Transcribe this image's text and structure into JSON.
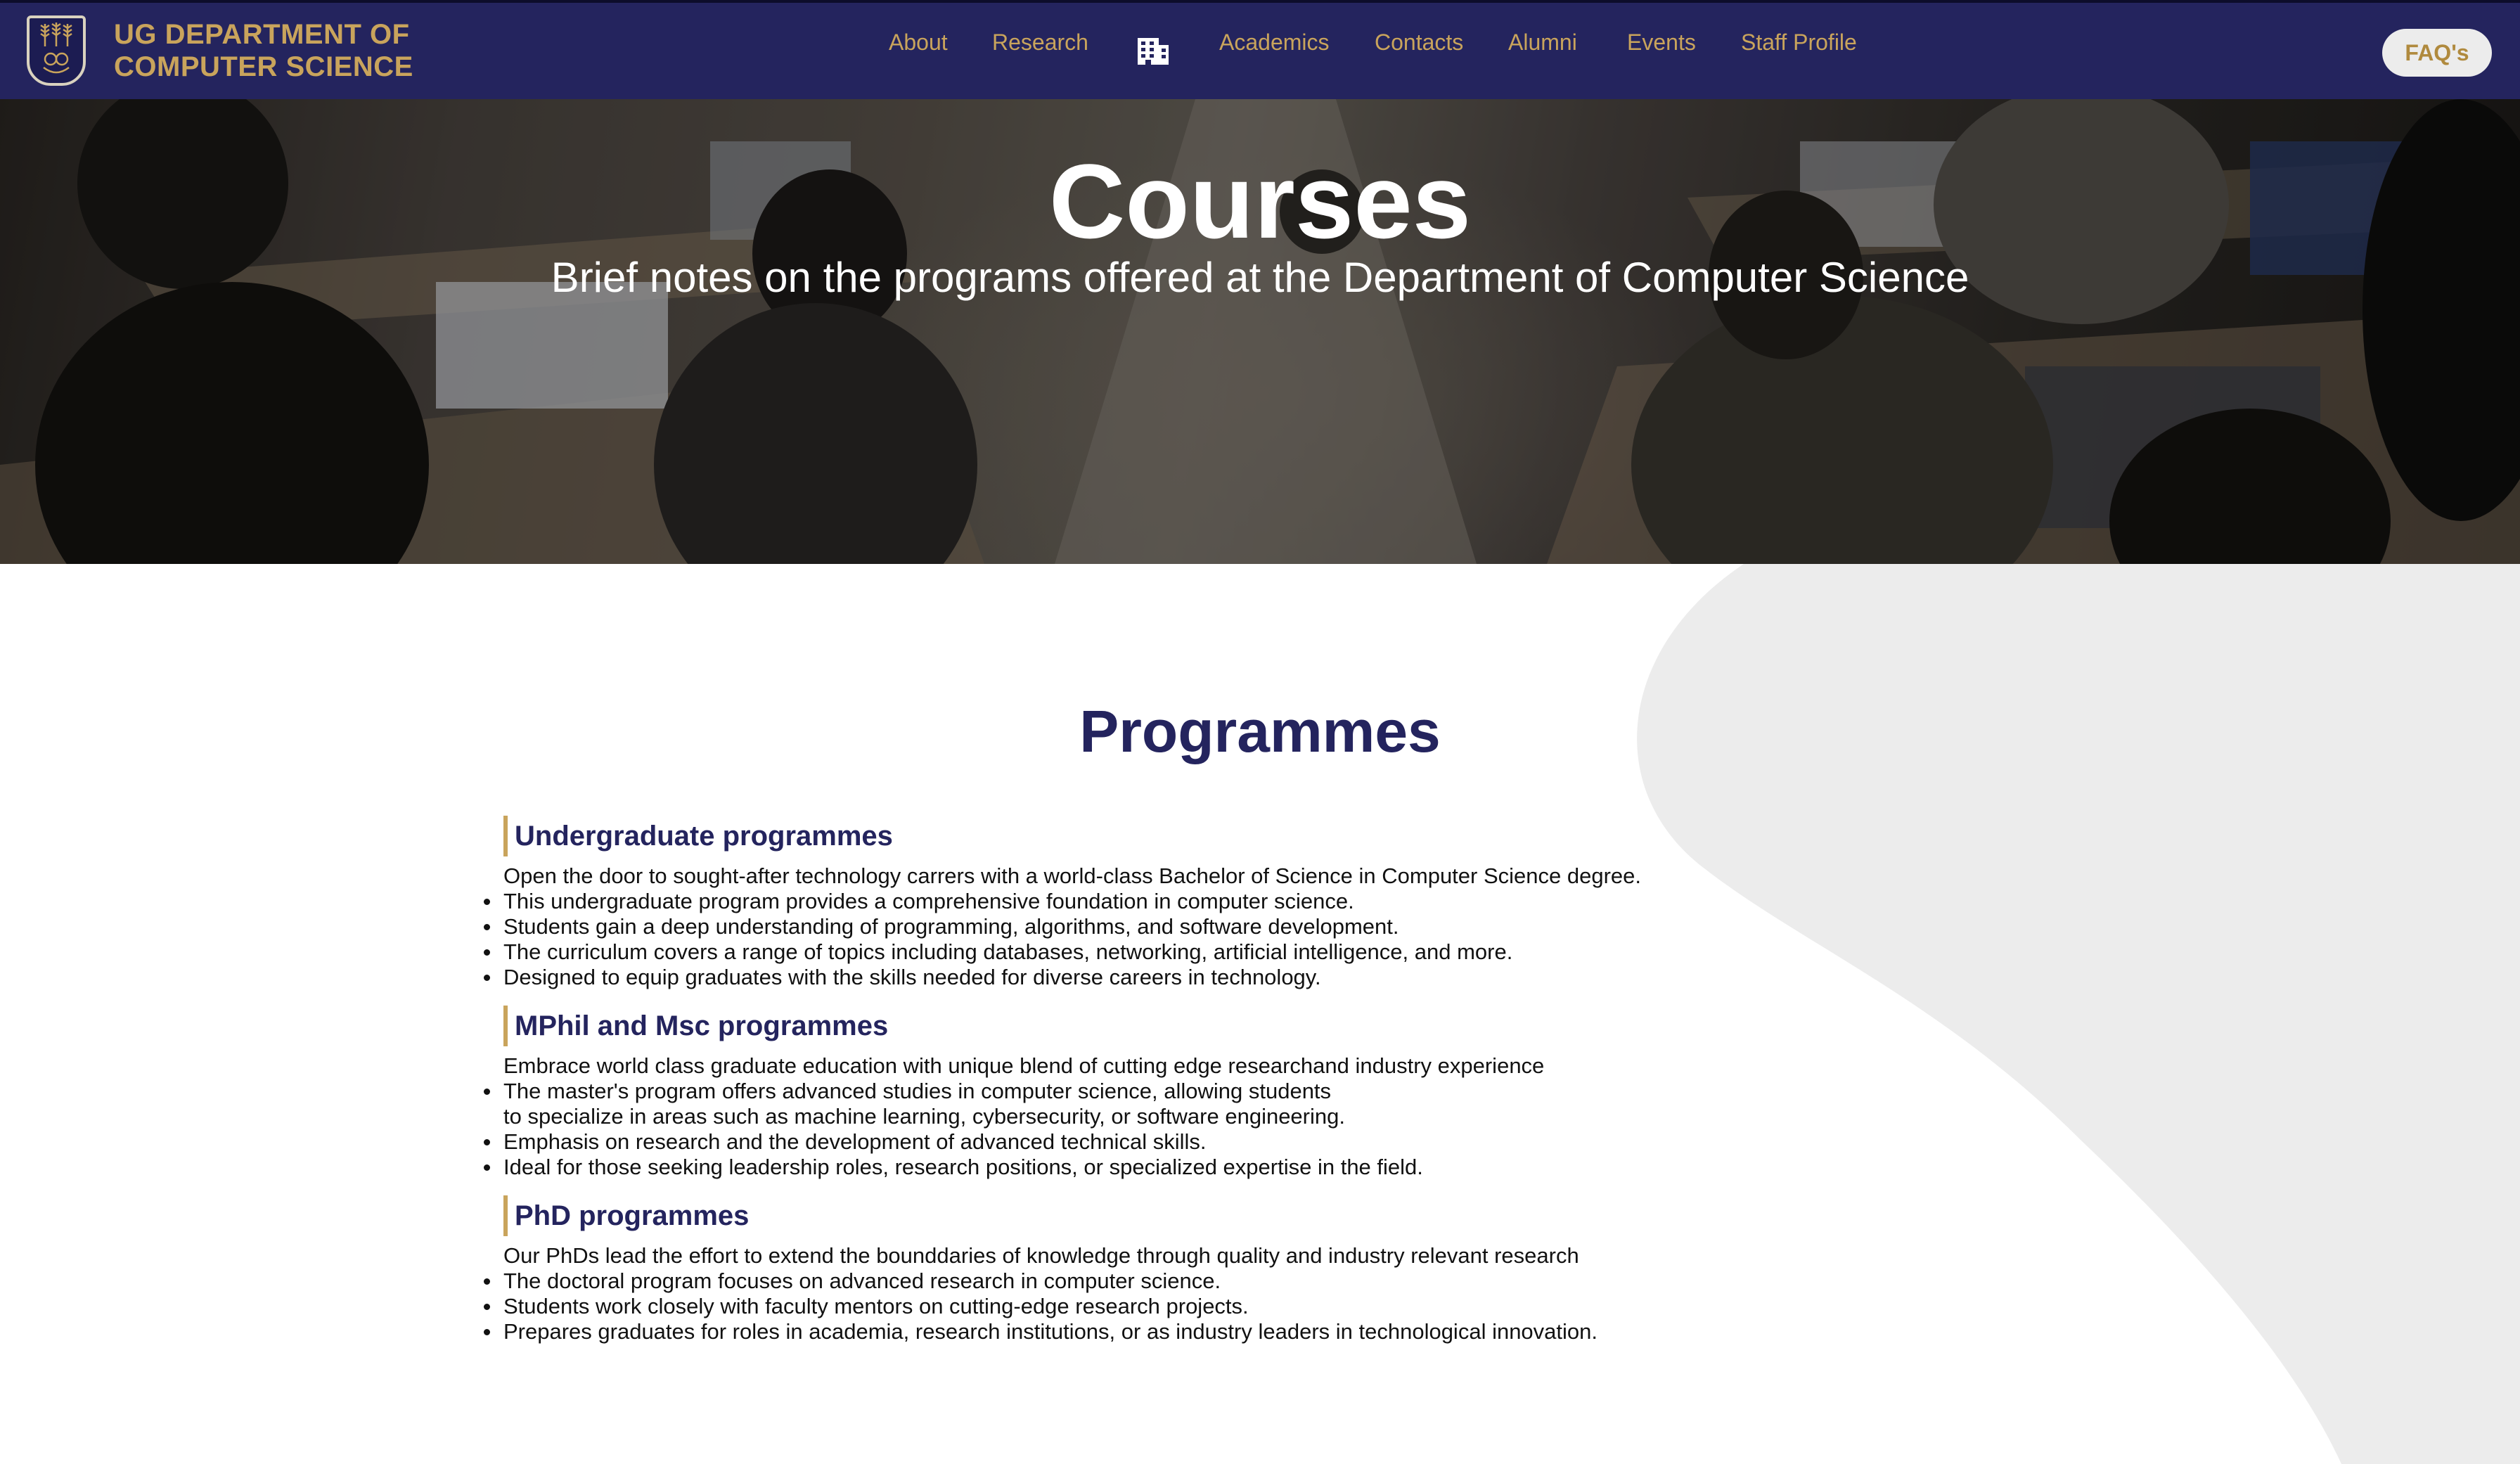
{
  "navbar": {
    "brand_line1": "UG DEPARTMENT OF",
    "brand_line2": "COMPUTER SCIENCE",
    "links": [
      "About",
      "Research",
      "Academics",
      "Contacts",
      "Alumni",
      "Events",
      "Staff Profile"
    ],
    "center_icon": "building-icon",
    "faq_label": "FAQ's"
  },
  "hero": {
    "title": "Courses",
    "subtitle": "Brief notes on the programs offered at the Department of Computer Science"
  },
  "main": {
    "section_title": "Programmes",
    "programmes": [
      {
        "heading": "Undergraduate programmes",
        "intro": "Open the door to sought-after technology carrers with a world-class Bachelor of Science in Computer Science degree.",
        "items": [
          [
            "This undergraduate program provides a comprehensive foundation in computer science."
          ],
          [
            "Students gain a deep understanding of programming, algorithms, and software development."
          ],
          [
            "The curriculum covers a range of topics including databases, networking, artificial intelligence, and more."
          ],
          [
            "Designed to equip graduates with the skills needed for diverse careers in technology."
          ]
        ]
      },
      {
        "heading": "MPhil and Msc programmes",
        "intro": "Embrace world class graduate education with unique blend of cutting edge researchand industry experience",
        "items": [
          [
            "The master's program offers advanced studies in computer science, allowing students",
            "to specialize in areas such as machine learning, cybersecurity, or software engineering."
          ],
          [
            "Emphasis on research and the development of advanced technical skills."
          ],
          [
            "Ideal for those seeking leadership roles, research positions, or specialized expertise in the field."
          ]
        ]
      },
      {
        "heading": "PhD programmes",
        "intro": "Our PhDs lead the effort to extend the bounddaries of knowledge through quality and industry relevant research",
        "items": [
          [
            "The doctoral program focuses on advanced research in computer science."
          ],
          [
            "Students work closely with faculty mentors on cutting-edge research projects."
          ],
          [
            "Prepares graduates for roles in academia, research institutions, or as industry leaders in technological innovation."
          ]
        ]
      }
    ]
  },
  "colors": {
    "navbar_bg": "#24245e",
    "accent_gold": "#c9a45c",
    "heading_navy": "#24245e",
    "wave_gray": "#ececec"
  }
}
